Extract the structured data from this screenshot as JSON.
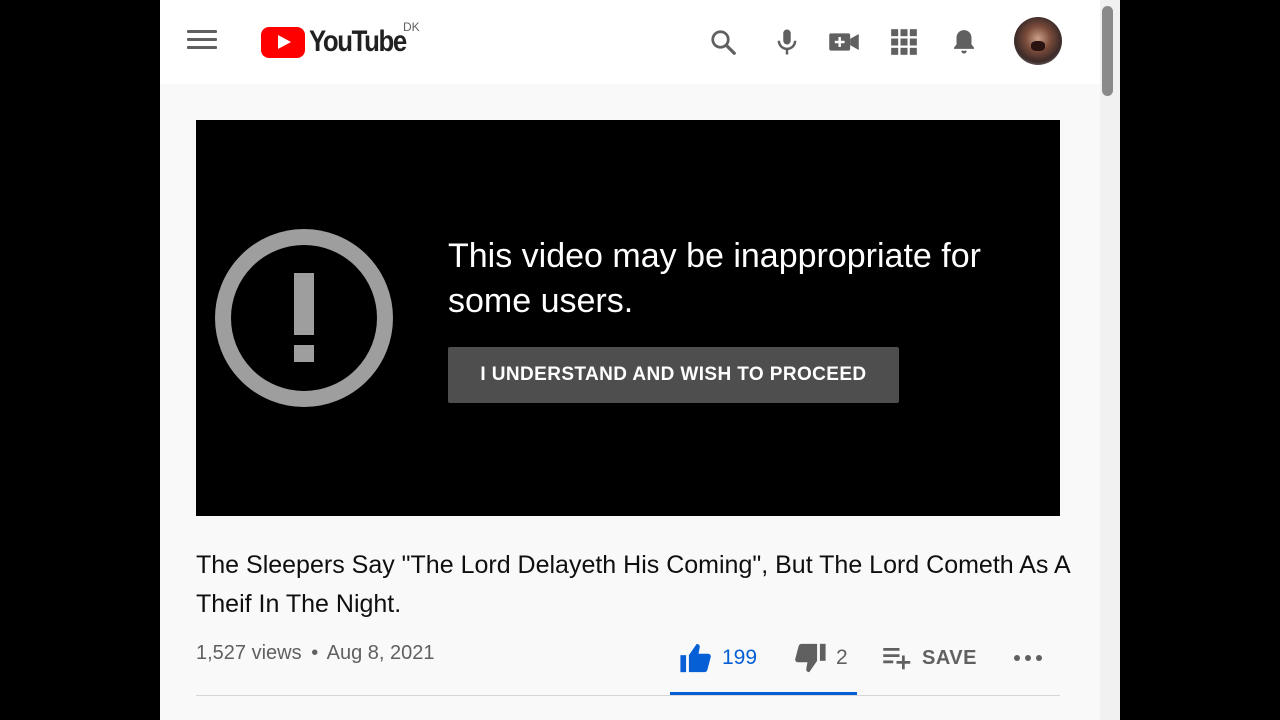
{
  "header": {
    "logo_text": "YouTube",
    "country_code": "DK",
    "icons": [
      "menu-icon",
      "search-icon",
      "mic-icon",
      "create-video-icon",
      "apps-icon",
      "notifications-icon"
    ]
  },
  "player": {
    "warning_message": "This video may be inappropriate for some users.",
    "proceed_button": "I UNDERSTAND AND WISH TO PROCEED"
  },
  "video": {
    "title": "The Sleepers Say \"The Lord Delayeth His Coming\", But The Lord Cometh As A Theif In The Night.",
    "views": "1,527 views",
    "separator": "•",
    "date": "Aug 8, 2021",
    "likes": "199",
    "dislikes": "2",
    "save_label": "SAVE"
  },
  "colors": {
    "brand_red": "#ff0000",
    "like_blue": "#065fd4",
    "button_gray": "#4e4e4e"
  }
}
